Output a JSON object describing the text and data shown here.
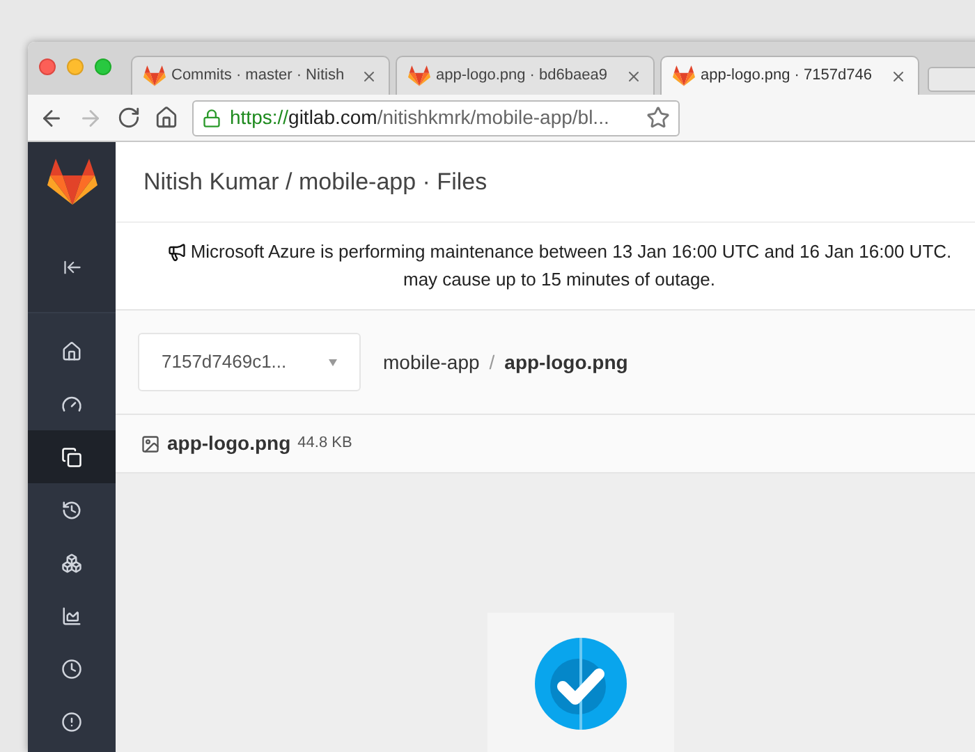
{
  "browser": {
    "tabs": [
      {
        "title": "Commits · master · Nitish",
        "selected": false
      },
      {
        "title": "app-logo.png · bd6baea9",
        "selected": false
      },
      {
        "title": "app-logo.png · 7157d746",
        "selected": true
      }
    ],
    "url": {
      "scheme": "https://",
      "host": "gitlab.com",
      "path": "/nitishkmrk/mobile-app/bl..."
    }
  },
  "sidebar": {
    "items": [
      {
        "kind": "home",
        "selected": false
      },
      {
        "kind": "dashboard",
        "selected": false
      },
      {
        "kind": "files",
        "selected": true
      },
      {
        "kind": "history",
        "selected": false
      },
      {
        "kind": "boxes",
        "selected": false
      },
      {
        "kind": "chart",
        "selected": false
      },
      {
        "kind": "clock",
        "selected": false
      },
      {
        "kind": "alert",
        "selected": false
      }
    ]
  },
  "page": {
    "title": "Nitish Kumar / mobile-app · Files",
    "banner": [
      "Microsoft Azure is performing maintenance between 13 Jan 16:00 UTC and 16 Jan 16:00 UTC.",
      "may cause up to 15 minutes of outage."
    ],
    "ref_select": "7157d7469c1...",
    "breadcrumb": {
      "project": "mobile-app",
      "separator": "/",
      "file": "app-logo.png"
    },
    "file": {
      "name": "app-logo.png",
      "size": "44.8 KB"
    }
  }
}
